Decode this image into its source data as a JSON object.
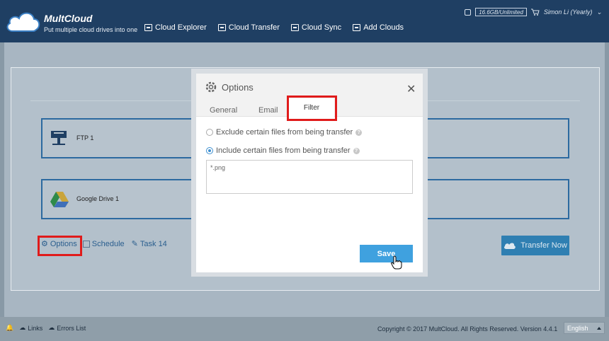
{
  "header": {
    "brand": "MultCloud",
    "tagline": "Put multiple cloud drives into one",
    "nav": [
      {
        "label": "Cloud Explorer",
        "icon": "cloud-explorer-icon"
      },
      {
        "label": "Cloud Transfer",
        "icon": "cloud-transfer-icon"
      },
      {
        "label": "Cloud Sync",
        "icon": "cloud-sync-icon"
      },
      {
        "label": "Add Clouds",
        "icon": "add-clouds-icon"
      }
    ],
    "storage": "16.6GB/Unlimited",
    "user": "Simon Li (Yearly)"
  },
  "transfer": {
    "source": "FTP 1",
    "target": "Google Drive 1",
    "options_label": "Options",
    "schedule_label": "Schedule",
    "task_label": "Task 14",
    "transfer_now_label": "Transfer Now"
  },
  "modal": {
    "title": "Options",
    "tabs": {
      "general": "General",
      "email": "Email",
      "filter": "Filter"
    },
    "exclude_label": "Exclude certain files from being transfer",
    "include_label": "Include certain files from being transfer",
    "filter_value": "*.png",
    "save_label": "Save",
    "selected": "include"
  },
  "footer": {
    "links_label": "Links",
    "errors_label": "Errors List",
    "copyright": "Copyright © 2017 MultCloud. All Rights Reserved. Version 4.4.1",
    "language": "English"
  },
  "colors": {
    "header_bg": "#1f3f63",
    "accent": "#3fa1df",
    "highlight": "#e01b1b",
    "drive_border": "#2c6aa0"
  }
}
